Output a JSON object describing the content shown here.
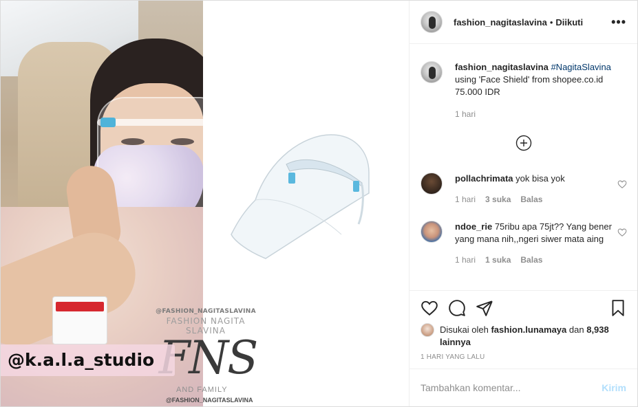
{
  "media": {
    "watermark_top": "@FASHION_NAGITASLAVINA",
    "watermark_name": "FASHION NAGITA SLAVINA",
    "watermark_logo": "FNS",
    "watermark_family": "AND FAMILY",
    "watermark_bottom": "@FASHION_NAGITASLAVINA",
    "studio_tag": "@k.a.l.a_studio"
  },
  "header": {
    "username": "fashion_nagitaslavina",
    "separator": "•",
    "follow_status": "Diikuti",
    "more_icon": "more-options-icon"
  },
  "caption": {
    "username": "fashion_nagitaslavina",
    "hashtag": "#NagitaSlavina",
    "text": "using 'Face Shield' from shopee.co.id 75.000 IDR",
    "time": "1 hari"
  },
  "load_more_icon": "plus-circle-icon",
  "comments": [
    {
      "username": "pollachrimata",
      "text": "yok bisa yok",
      "time": "1 hari",
      "likes": "3 suka",
      "reply": "Balas"
    },
    {
      "username": "ndoe_rie",
      "text": "75ribu apa 75jt?? Yang bener yang mana nih,,ngeri siwer mata aing",
      "time": "1 hari",
      "likes": "1 suka",
      "reply": "Balas"
    }
  ],
  "actions": {
    "like_icon": "heart-icon",
    "comment_icon": "comment-icon",
    "share_icon": "share-icon",
    "save_icon": "bookmark-icon"
  },
  "likes": {
    "prefix": "Disukai oleh",
    "user": "fashion.lunamaya",
    "middle": "dan",
    "count": "8,938 lainnya"
  },
  "timestamp": "1 HARI YANG LALU",
  "composer": {
    "placeholder": "Tambahkan komentar...",
    "post_label": "Kirim",
    "post_color": "#b2dffc"
  }
}
